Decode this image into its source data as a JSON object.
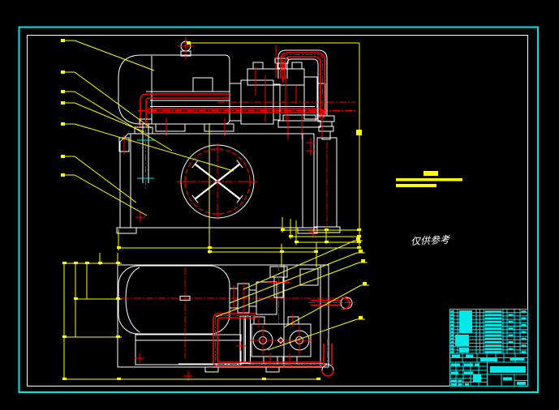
{
  "annotations": {
    "reference_note": "仅供参考"
  },
  "palette": {
    "background": "#000000",
    "sheet_border": "#00e9e9",
    "linework": "#ffffff",
    "piping_centerline": "#ff0000",
    "dimension_leader": "#ffff00",
    "title_block": "#00e9e9"
  }
}
